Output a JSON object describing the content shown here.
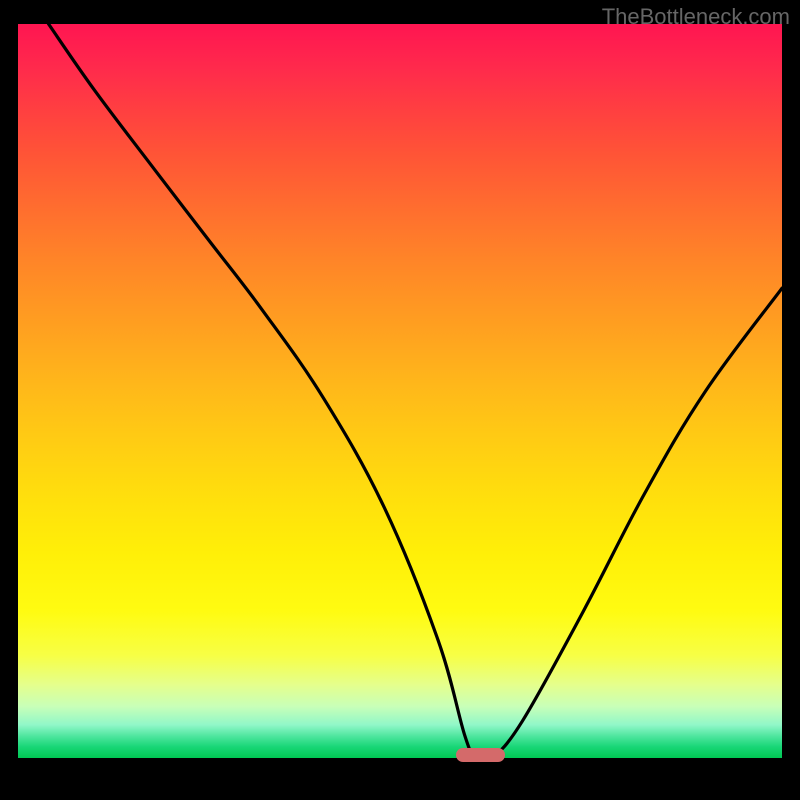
{
  "watermark": "TheBottleneck.com",
  "colors": {
    "marker": "#d46a6a",
    "curve": "#000000",
    "page_bg": "#000000"
  },
  "chart_data": {
    "type": "line",
    "title": "",
    "xlabel": "",
    "ylabel": "",
    "xlim": [
      0,
      100
    ],
    "ylim": [
      0,
      100
    ],
    "grid": false,
    "series": [
      {
        "name": "bottleneck-curve",
        "x": [
          4,
          10,
          18,
          25,
          32,
          40,
          48,
          55,
          58.5,
          60,
          62,
          66,
          74,
          82,
          90,
          100
        ],
        "y": [
          100,
          91,
          80,
          70.5,
          61,
          49,
          34,
          16,
          3,
          0,
          0,
          5,
          20,
          36,
          50,
          64
        ]
      }
    ],
    "marker": {
      "x": 60.5,
      "y": 0.4,
      "w": 6.4,
      "h": 1.8
    }
  }
}
